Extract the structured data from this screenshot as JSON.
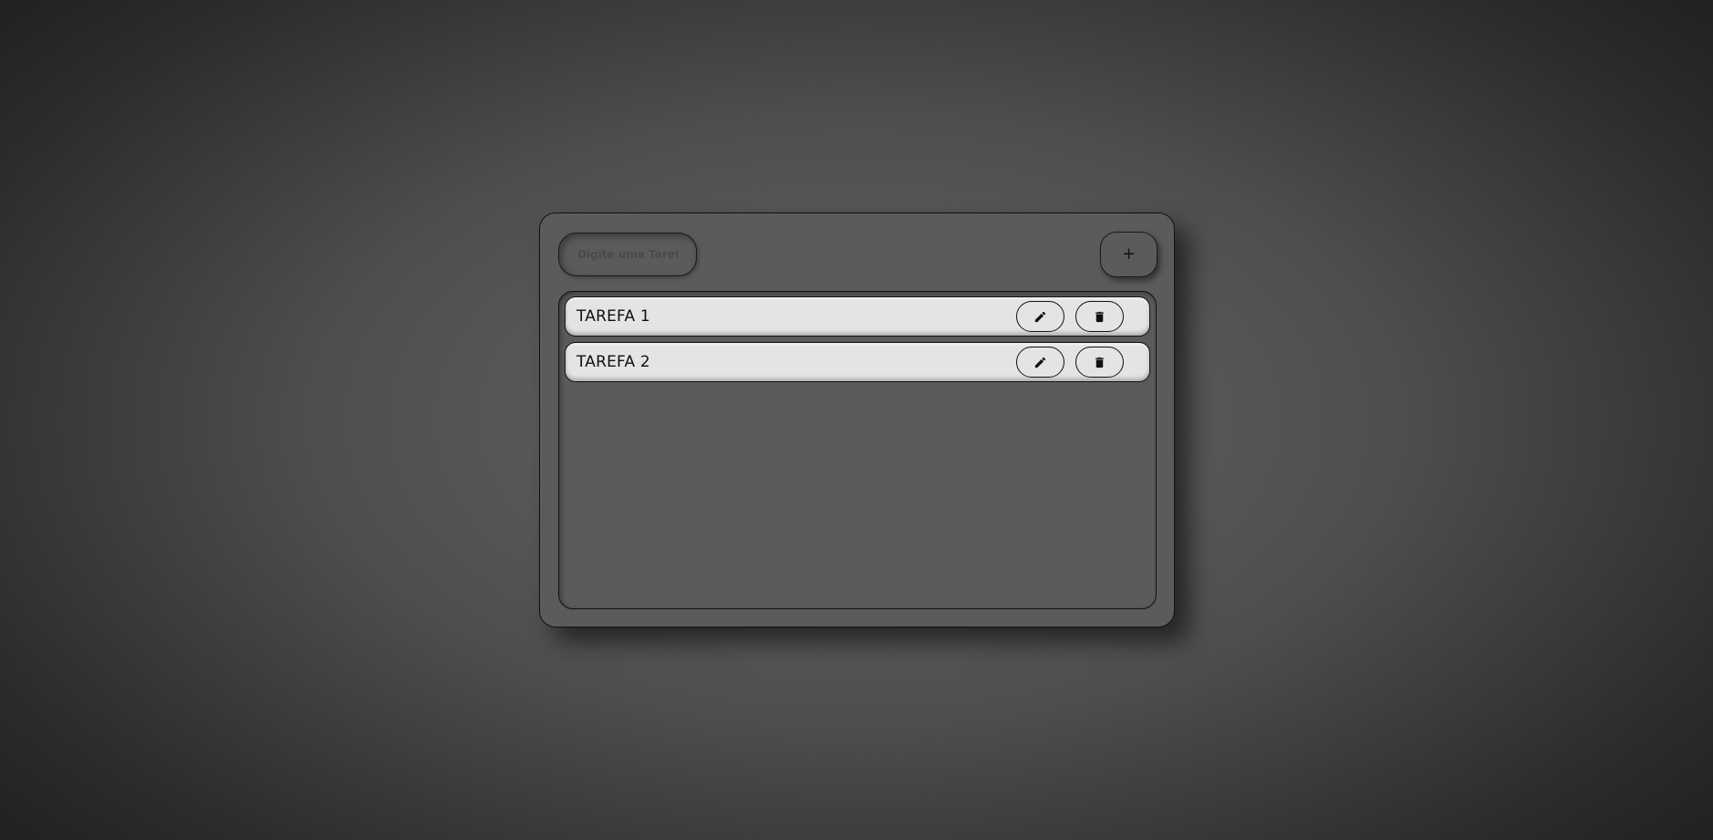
{
  "input": {
    "placeholder": "Digite uma Tarefa...",
    "value": ""
  },
  "add_button": {
    "label": "+"
  },
  "tasks": [
    {
      "label": "TAREFA 1",
      "edit_icon": "pencil-icon",
      "delete_icon": "trash-icon"
    },
    {
      "label": "TAREFA 2",
      "edit_icon": "pencil-icon",
      "delete_icon": "trash-icon"
    }
  ],
  "colors": {
    "background_center": "#666666",
    "background_edge": "#1d1d1d",
    "card": "#5b5b5b",
    "task_item": "#e6e4e3",
    "border": "#111111"
  }
}
